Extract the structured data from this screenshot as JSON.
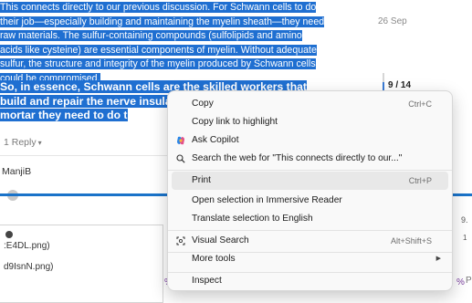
{
  "post": {
    "para1": "This connects directly to our previous discussion. For Schwann cells to do their job—especially building and maintaining the myelin sheath—they need raw materials. The sulfur-containing compounds (sulfolipids and amino acids like cysteine) are essential components of myelin. Without adequate sulfur, the structure and integrity of the myelin produced by Schwann cells could be compromised.",
    "para2": "So, in essence, Schwann cells are the skilled workers that build and repair the nerve insulation, and sulf bricks and mortar they need to do t",
    "reply_count": "1 Reply",
    "username": "ManjiB"
  },
  "timeline": {
    "date": "26 Sep",
    "counter": "9 / 14"
  },
  "downloads": {
    "file1": ":E4DL.png)",
    "file2": "d9IsnN.png)"
  },
  "fragments": {
    "right_a": "9.",
    "right_b": "1",
    "pct_left": "%",
    "pct_right": "%",
    "right_d": "P"
  },
  "context_menu": {
    "items": [
      {
        "label": "Copy",
        "shortcut": "Ctrl+C"
      },
      {
        "label": "Copy link to highlight",
        "shortcut": ""
      },
      {
        "label": "Ask Copilot",
        "shortcut": ""
      },
      {
        "label": "Search the web for \"This connects directly to our...\"",
        "shortcut": ""
      },
      {
        "label": "Print",
        "shortcut": "Ctrl+P"
      },
      {
        "label": "Open selection in Immersive Reader",
        "shortcut": ""
      },
      {
        "label": "Translate selection to English",
        "shortcut": ""
      },
      {
        "label": "Visual Search",
        "shortcut": "Alt+Shift+S"
      },
      {
        "label": "More tools",
        "shortcut": ""
      },
      {
        "label": "Inspect",
        "shortcut": ""
      }
    ],
    "highlighted_item": "Print"
  },
  "colors": {
    "selection": "#1f6fd1",
    "menu_bg": "#f9f9f9",
    "highlight": "#e8e8e8"
  }
}
